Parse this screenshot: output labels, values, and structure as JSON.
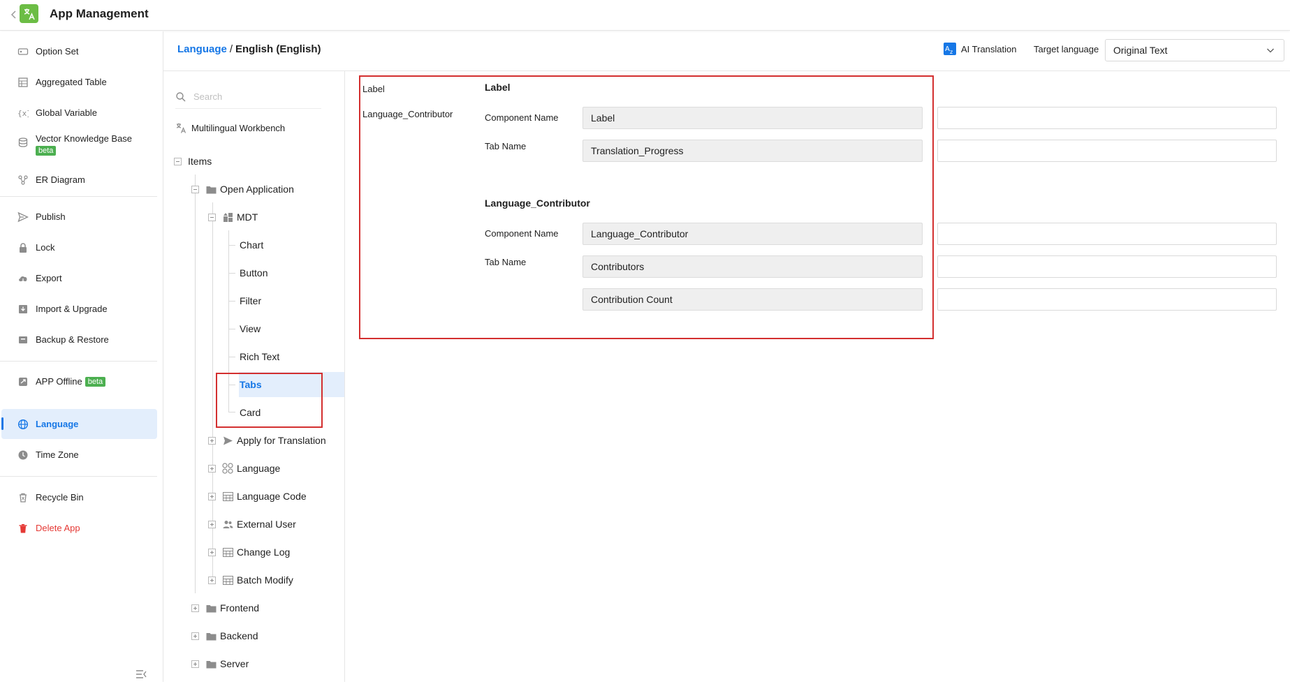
{
  "header": {
    "back_icon": "chevron-left-icon",
    "logo_icon": "translate-logo-icon",
    "title": "App Management"
  },
  "sidebar": {
    "items": [
      {
        "label": "Option Set",
        "icon": "option-set-icon"
      },
      {
        "label": "Aggregated Table",
        "icon": "aggregated-table-icon"
      },
      {
        "label": "Global Variable",
        "icon": "variable-icon"
      },
      {
        "label": "Vector Knowledge Base",
        "badge": "beta",
        "icon": "database-icon"
      },
      {
        "label": "ER Diagram",
        "icon": "er-diagram-icon"
      },
      {
        "label": "Publish",
        "icon": "send-icon"
      },
      {
        "label": "Lock",
        "icon": "lock-icon"
      },
      {
        "label": "Export",
        "icon": "cloud-export-icon"
      },
      {
        "label": "Import & Upgrade",
        "icon": "import-icon"
      },
      {
        "label": "Backup & Restore",
        "icon": "backup-icon"
      },
      {
        "label": "APP Offline",
        "badge": "beta",
        "icon": "offline-icon"
      },
      {
        "label": "Language",
        "icon": "globe-icon",
        "active": true
      },
      {
        "label": "Time Zone",
        "icon": "clock-icon"
      },
      {
        "label": "Recycle Bin",
        "icon": "recycle-bin-icon"
      },
      {
        "label": "Delete App",
        "icon": "trash-icon",
        "color": "#e53935"
      }
    ]
  },
  "breadcrumb": {
    "root": "Language",
    "separator": "/",
    "current": "English (English)"
  },
  "toolbar": {
    "ai_translation": "AI Translation",
    "target_language_label": "Target language",
    "target_language_value": "Original Text"
  },
  "tree": {
    "search_placeholder": "Search",
    "workbench": "Multilingual Workbench",
    "items_label": "Items",
    "open_application": "Open Application",
    "mdt": "MDT",
    "mdt_children": [
      "Chart",
      "Button",
      "Filter",
      "View",
      "Rich Text",
      "Tabs",
      "Card"
    ],
    "selected": "Tabs",
    "app_children": [
      "Apply for Translation",
      "Language",
      "Language Code",
      "External User",
      "Change Log",
      "Batch Modify"
    ],
    "root_siblings": [
      "Frontend",
      "Backend",
      "Server"
    ]
  },
  "content": {
    "anchors": [
      "Label",
      "Language_Contributor"
    ],
    "sections": [
      {
        "title": "Label",
        "component_name_label": "Component Name",
        "component_name": "Label",
        "tab_name_label": "Tab Name",
        "tab_names": [
          "Translation_Progress"
        ]
      },
      {
        "title": "Language_Contributor",
        "component_name_label": "Component Name",
        "component_name": "Language_Contributor",
        "tab_name_label": "Tab Name",
        "tab_names": [
          "Contributors",
          "Contribution Count"
        ]
      }
    ]
  },
  "colors": {
    "accent": "#1677e6",
    "active_bg": "#e3eefc",
    "logo": "#6cbd45",
    "beta": "#4caf50",
    "danger": "#e53935",
    "highlight": "#d32f2f"
  }
}
